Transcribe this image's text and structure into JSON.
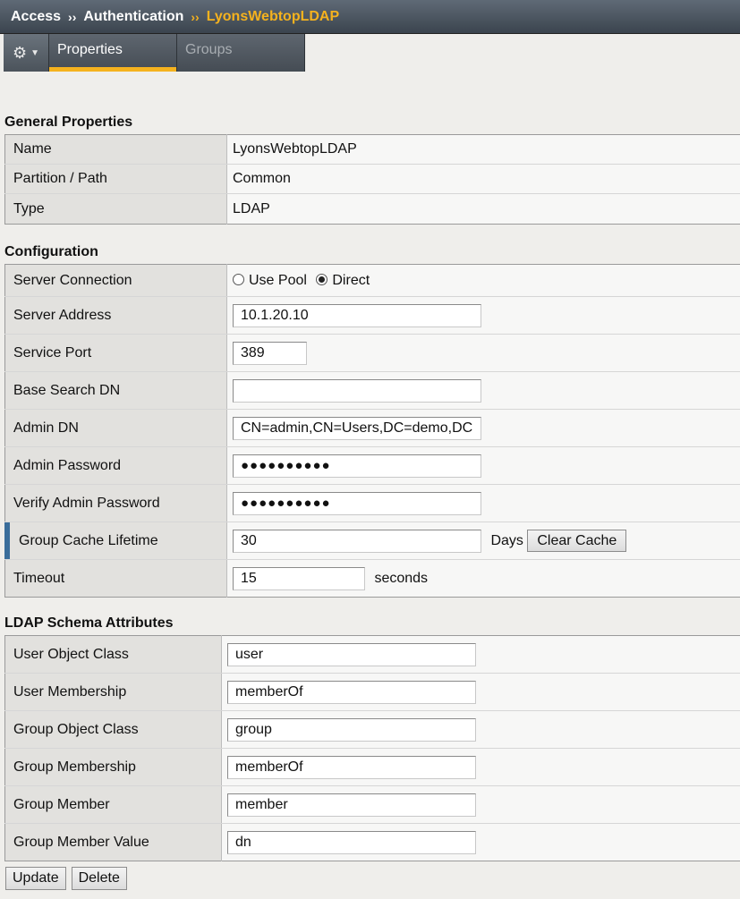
{
  "breadcrumb": {
    "items": [
      "Access",
      "Authentication"
    ],
    "separator": "››",
    "current": "LyonsWebtopLDAP"
  },
  "tabs": {
    "gear_icon": "gear-icon",
    "items": [
      {
        "label": "Properties",
        "active": true
      },
      {
        "label": "Groups",
        "active": false
      }
    ]
  },
  "general": {
    "title": "General Properties",
    "rows": [
      {
        "label": "Name",
        "value": "LyonsWebtopLDAP"
      },
      {
        "label": "Partition / Path",
        "value": "Common"
      },
      {
        "label": "Type",
        "value": "LDAP"
      }
    ]
  },
  "configuration": {
    "title": "Configuration",
    "server_connection": {
      "label": "Server Connection",
      "options": [
        "Use Pool",
        "Direct"
      ],
      "selected": "Direct"
    },
    "server_address": {
      "label": "Server Address",
      "value": "10.1.20.10"
    },
    "service_port": {
      "label": "Service Port",
      "value": "389"
    },
    "base_search_dn": {
      "label": "Base Search DN",
      "value": ""
    },
    "admin_dn": {
      "label": "Admin DN",
      "value": "CN=admin,CN=Users,DC=demo,DC="
    },
    "admin_password": {
      "label": "Admin Password",
      "value": "●●●●●●●●●●"
    },
    "verify_admin_password": {
      "label": "Verify Admin Password",
      "value": "●●●●●●●●●●"
    },
    "group_cache_lifetime": {
      "label": "Group Cache Lifetime",
      "value": "30",
      "unit": "Days",
      "button": "Clear Cache"
    },
    "timeout": {
      "label": "Timeout",
      "value": "15",
      "unit": "seconds"
    }
  },
  "schema": {
    "title": "LDAP Schema Attributes",
    "rows": [
      {
        "label": "User Object Class",
        "value": "user"
      },
      {
        "label": "User Membership",
        "value": "memberOf"
      },
      {
        "label": "Group Object Class",
        "value": "group"
      },
      {
        "label": "Group Membership",
        "value": "memberOf"
      },
      {
        "label": "Group Member",
        "value": "member"
      },
      {
        "label": "Group Member Value",
        "value": "dn"
      }
    ]
  },
  "actions": {
    "update": "Update",
    "delete": "Delete"
  },
  "colors": {
    "accent": "#f5b21e",
    "marker": "#3a6d9a",
    "header_bg": "#4b545e"
  }
}
